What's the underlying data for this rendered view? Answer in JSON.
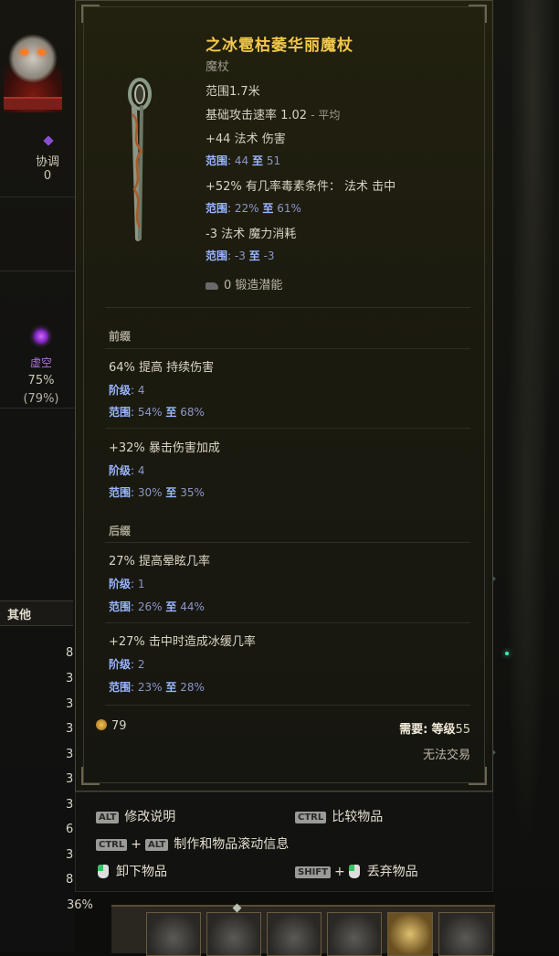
{
  "sidebar": {
    "attunement_label": "协调",
    "attunement_value": "0",
    "void_label": "虚空",
    "void_pct": "75%",
    "void_pct_paren": "(79%)",
    "other_label": "其他",
    "stat_numbers": [
      "8",
      "3",
      "3",
      "3",
      "3",
      "3",
      "3",
      "6",
      "3",
      "8"
    ],
    "bottom_pct": "36%"
  },
  "item": {
    "name": "之冰雹枯萎华丽魔杖",
    "type": "魔杖",
    "range_line": "范围1.7米",
    "attack_speed_label": "基础攻击速率 1.02",
    "attack_speed_suffix": "- 平均",
    "implicits": [
      {
        "text": "+44 法术 伤害",
        "range_label": "范围",
        "min": "44",
        "to": "至",
        "max": "51"
      },
      {
        "text": "+52% 有几率毒素条件： 法术 击中",
        "range_label": "范围",
        "min": "22%",
        "to": "至",
        "max": "61%"
      },
      {
        "text": "-3 法术 魔力消耗",
        "range_label": "范围",
        "min": "-3",
        "to": "至",
        "max": "-3"
      }
    ],
    "forge_text": "0 锻造潜能",
    "prefix_header": "前缀",
    "prefixes": [
      {
        "text": "64% 提高 持续伤害",
        "tier_label": "阶级",
        "tier": "4",
        "range_label": "范围",
        "min": "54%",
        "to": "至",
        "max": "68%"
      },
      {
        "text": "+32% 暴击伤害加成",
        "tier_label": "阶级",
        "tier": "4",
        "range_label": "范围",
        "min": "30%",
        "to": "至",
        "max": "35%"
      }
    ],
    "suffix_header": "后缀",
    "suffixes": [
      {
        "text": "27% 提高晕眩几率",
        "tier_label": "阶级",
        "tier": "1",
        "range_label": "范围",
        "min": "26%",
        "to": "至",
        "max": "44%"
      },
      {
        "text": "+27% 击中时造成冰缓几率",
        "tier_label": "阶级",
        "tier": "2",
        "range_label": "范围",
        "min": "23%",
        "to": "至",
        "max": "28%"
      }
    ],
    "gold_value": "79",
    "requirement_label": "需要:",
    "requirement_level_label": "等级",
    "requirement_level": "55",
    "untradeable": "无法交易"
  },
  "hints": {
    "alt_key": "ALT",
    "alt_text": "修改说明",
    "ctrl_key": "CTRL",
    "ctrl_text": "比较物品",
    "ctrl_alt_text": "制作和物品滚动信息",
    "plus": "+",
    "unequip_text": "卸下物品",
    "shift_key": "SHIFT",
    "drop_text": "丢弃物品"
  },
  "colors": {
    "item_name": "#f2c84a",
    "range_blue": "#9ab6ff",
    "panel_bg": "#1c1b0f"
  }
}
